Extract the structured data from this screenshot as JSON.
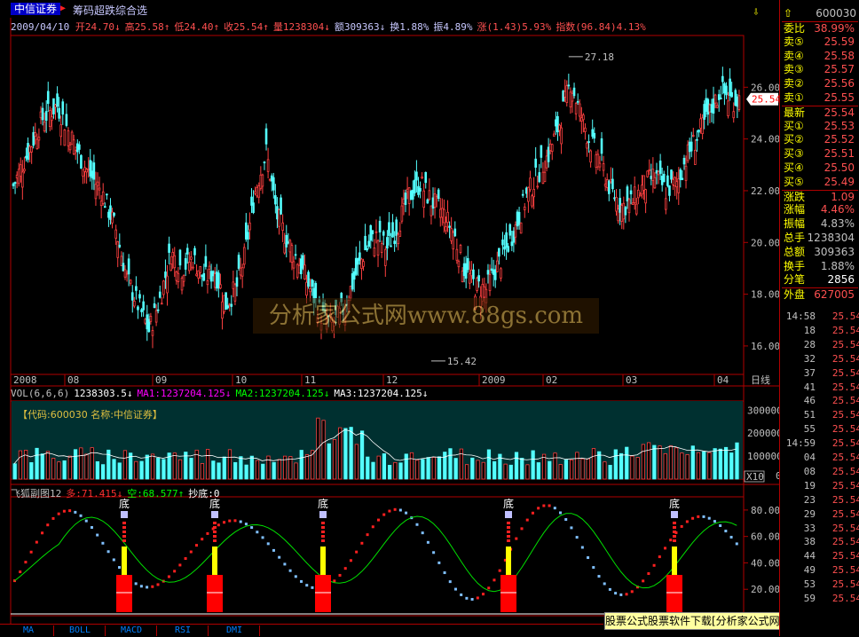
{
  "title_bar": {
    "stock_name": "中信证券",
    "formula_name": "筹码超跌综合选",
    "config_icon": "lock-icon"
  },
  "info": {
    "date": "2009/04/10",
    "items": [
      {
        "text": "开24.70↓",
        "color": "#ff5050"
      },
      {
        "text": "高25.58↑",
        "color": "#ff5050"
      },
      {
        "text": "低24.40↑",
        "color": "#ff5050"
      },
      {
        "text": "收25.54↑",
        "color": "#ff5050"
      },
      {
        "text": "量1238304↓",
        "color": "#ff5050"
      },
      {
        "text": "额309363↓",
        "color": "#c8c8ff"
      },
      {
        "text": "换1.88%",
        "color": "#c8c8ff"
      },
      {
        "text": "振4.89%",
        "color": "#c8c8ff"
      },
      {
        "text": "涨(1.43)5.93%",
        "color": "#ff5050"
      },
      {
        "text": "指数(96.84)4.13%",
        "color": "#ff5050"
      }
    ]
  },
  "main_chart": {
    "y_axis": [
      "26.00",
      "24.00",
      "22.00",
      "20.00",
      "18.00",
      "16.00"
    ],
    "current_price_tag": "25.54",
    "max_label": "27.18",
    "min_label": "15.42",
    "x_axis": [
      "2008",
      "08",
      "09",
      "10",
      "11",
      "12",
      "2009",
      "02",
      "03",
      "04"
    ],
    "period_label": "日线",
    "watermark": "分析家公式网www.88gs.com"
  },
  "volume": {
    "header": [
      {
        "text": "VOL(6,6,6)",
        "color": "#c0c0c0"
      },
      {
        "text": "1238303.5↓",
        "color": "#ffffff"
      },
      {
        "text": "MA1:1237204.125↓",
        "color": "#ff00ff"
      },
      {
        "text": "MA2:1237204.125↓",
        "color": "#00ff00"
      },
      {
        "text": "MA3:1237204.125↓",
        "color": "#ffffff"
      }
    ],
    "stock_label": "【代码:600030 名称:中信证券】",
    "y_axis": [
      "300000",
      "200000",
      "100000",
      "0"
    ],
    "unit": "X10"
  },
  "indicator": {
    "header": [
      {
        "text": "飞狐副图12",
        "color": "#c0c0c0"
      },
      {
        "text": "多:71.415↓",
        "color": "#ff3030"
      },
      {
        "text": "空:68.577↑",
        "color": "#00ff00"
      },
      {
        "text": "抄底:0",
        "color": "#ffffff"
      }
    ],
    "y_axis": [
      "80.00",
      "60.00",
      "40.00",
      "20.00"
    ],
    "bottom_marker_label": "底"
  },
  "tabs": [
    "MA",
    "BOLL",
    "MACD",
    "RSI",
    "DMI"
  ],
  "footer": "股票公式股票软件下载[分析家公式网www.88gs.com]",
  "quote": {
    "code": "600030",
    "wei_bi": {
      "label": "委比",
      "value": "38.99%"
    },
    "sell": [
      {
        "label": "卖⑤",
        "price": "25.59"
      },
      {
        "label": "卖④",
        "price": "25.58"
      },
      {
        "label": "卖③",
        "price": "25.57"
      },
      {
        "label": "卖②",
        "price": "25.56"
      },
      {
        "label": "卖①",
        "price": "25.55"
      }
    ],
    "latest": {
      "label": "最新",
      "price": "25.54"
    },
    "buy": [
      {
        "label": "买①",
        "price": "25.53"
      },
      {
        "label": "买②",
        "price": "25.52"
      },
      {
        "label": "买③",
        "price": "25.51"
      },
      {
        "label": "买④",
        "price": "25.50"
      },
      {
        "label": "买⑤",
        "price": "25.49"
      }
    ],
    "stats": [
      {
        "label": "涨跌",
        "value": "1.09",
        "color": "#ff5050"
      },
      {
        "label": "涨幅",
        "value": "4.46%",
        "color": "#ff5050"
      },
      {
        "label": "振幅",
        "value": "4.83%",
        "color": "#c0c0c0"
      },
      {
        "label": "总手",
        "value": "1238304",
        "color": "#c0c0c0"
      },
      {
        "label": "总额",
        "value": "309363",
        "color": "#c0c0c0"
      },
      {
        "label": "换手",
        "value": "1.88%",
        "color": "#c0c0c0"
      },
      {
        "label": "分笔",
        "value": "2856",
        "color": "#ffffff"
      }
    ],
    "outer": {
      "label": "外盘",
      "value": "627005"
    },
    "ticks": [
      {
        "time": "14:58",
        "price": "25.54"
      },
      {
        "time": "18",
        "price": "25.54"
      },
      {
        "time": "28",
        "price": "25.54"
      },
      {
        "time": "32",
        "price": "25.54"
      },
      {
        "time": "37",
        "price": "25.54"
      },
      {
        "time": "41",
        "price": "25.54"
      },
      {
        "time": "46",
        "price": "25.54"
      },
      {
        "time": "51",
        "price": "25.54"
      },
      {
        "time": "55",
        "price": "25.54"
      },
      {
        "time": "14:59",
        "price": "25.54"
      },
      {
        "time": "04",
        "price": "25.54"
      },
      {
        "time": "08",
        "price": "25.54"
      },
      {
        "time": "19",
        "price": "25.54"
      },
      {
        "time": "23",
        "price": "25.54"
      },
      {
        "time": "29",
        "price": "25.54"
      },
      {
        "time": "33",
        "price": "25.54"
      },
      {
        "time": "38",
        "price": "25.54"
      },
      {
        "time": "44",
        "price": "25.54"
      },
      {
        "time": "49",
        "price": "25.54"
      },
      {
        "time": "53",
        "price": "25.54"
      },
      {
        "time": "59",
        "price": "25.54"
      }
    ]
  },
  "colors": {
    "up": "#ff4040",
    "down": "#54ffff",
    "grid": "#b00000",
    "axis_text": "#c0c0c0"
  }
}
